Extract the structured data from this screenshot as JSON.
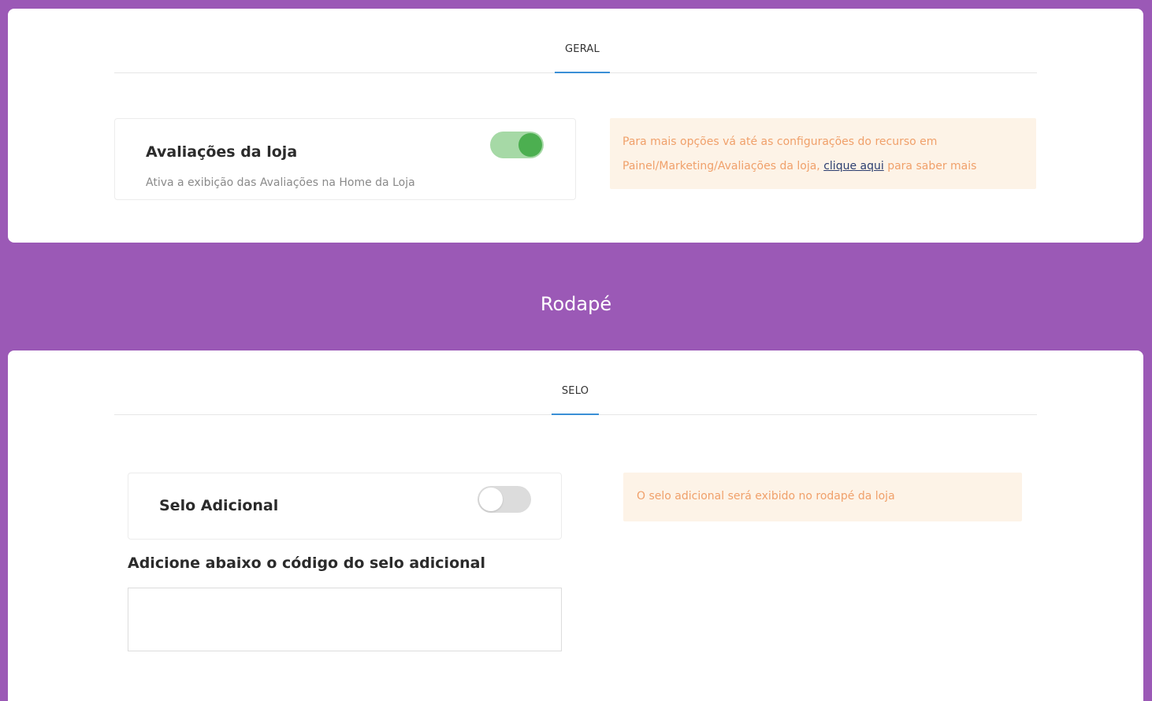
{
  "geral_section": {
    "tab_label": "GERAL",
    "option": {
      "title": "Avaliações da loja",
      "description": "Ativa a exibição das Avaliações na Home da Loja",
      "enabled": true
    },
    "info": {
      "text_before": "Para mais opções vá até as configurações do recurso em Painel/Marketing/Avaliações da loja, ",
      "link_text": "clique aqui",
      "text_after": " para saber mais"
    }
  },
  "footer_section": {
    "heading": "Rodapé",
    "tab_label": "SELO",
    "option": {
      "title": "Selo Adicional",
      "enabled": false
    },
    "info": {
      "text": "O selo adicional será exibido no rodapé da loja"
    },
    "code_label": "Adicione abaixo o código do selo adicional",
    "code_value": ""
  },
  "colors": {
    "background": "#9b59b6",
    "tab_underline": "#3a8fd6",
    "toggle_on": "#4caf50",
    "info_background": "#fdf3e7",
    "info_text": "#f0a06a"
  }
}
